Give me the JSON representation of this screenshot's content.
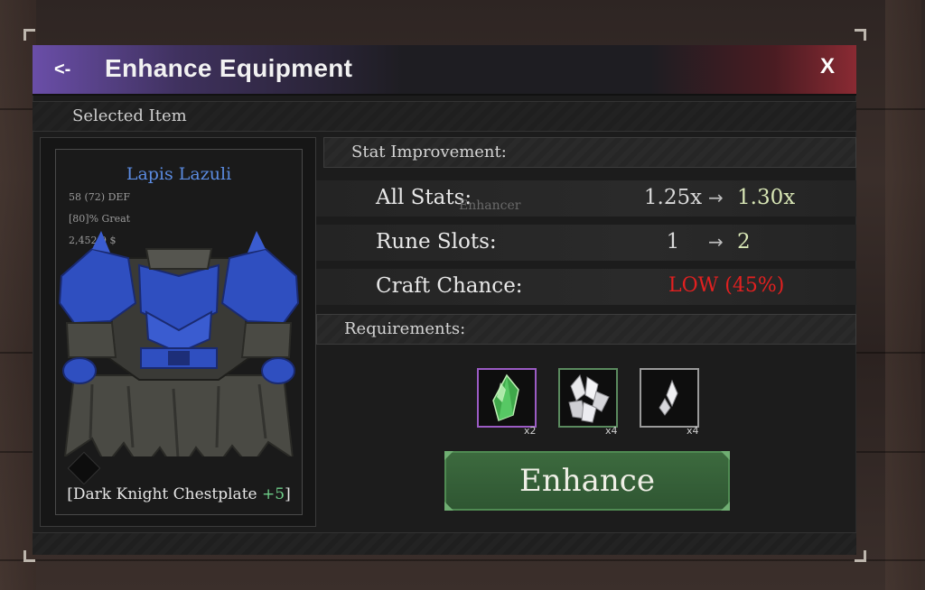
{
  "window": {
    "title": "Enhance Equipment",
    "back_label": "<-",
    "close_label": "X"
  },
  "selected_section": {
    "label": "Selected Item"
  },
  "item": {
    "name": "Lapis Lazuli",
    "defense": "58 (72) DEF",
    "quality": "[80]% Great",
    "value": "2,452.9 $",
    "title_prefix": "[Dark Knight Chestplate ",
    "enhance_level": "+5",
    "title_suffix": "]"
  },
  "stat_section": {
    "label": "Stat Improvement:"
  },
  "stats": {
    "all_stats": {
      "label": "All Stats:",
      "from": "1.25x",
      "to": "1.30x"
    },
    "rune_slots": {
      "label": "Rune Slots:",
      "from": "1",
      "to": "2"
    },
    "craft_chance": {
      "label": "Craft Chance:",
      "value": "LOW (45%)"
    },
    "arrow": "→"
  },
  "background_label": "Enhancer",
  "requirements": {
    "label": "Requirements:",
    "items": [
      {
        "icon": "green-crystal-icon",
        "count": "x2",
        "border_color": "#9b5bc4"
      },
      {
        "icon": "white-crystal-cluster-icon",
        "count": "x4",
        "border_color": "#5a8a5e"
      },
      {
        "icon": "white-shard-icon",
        "count": "x4",
        "border_color": "#9a9a9a"
      }
    ]
  },
  "enhance_button": {
    "label": "Enhance"
  },
  "colors": {
    "item_name": "#5b8be0",
    "craft_chance": "#e22020",
    "enhance_plus": "#6fd08a",
    "button": "#3c6a3e"
  }
}
